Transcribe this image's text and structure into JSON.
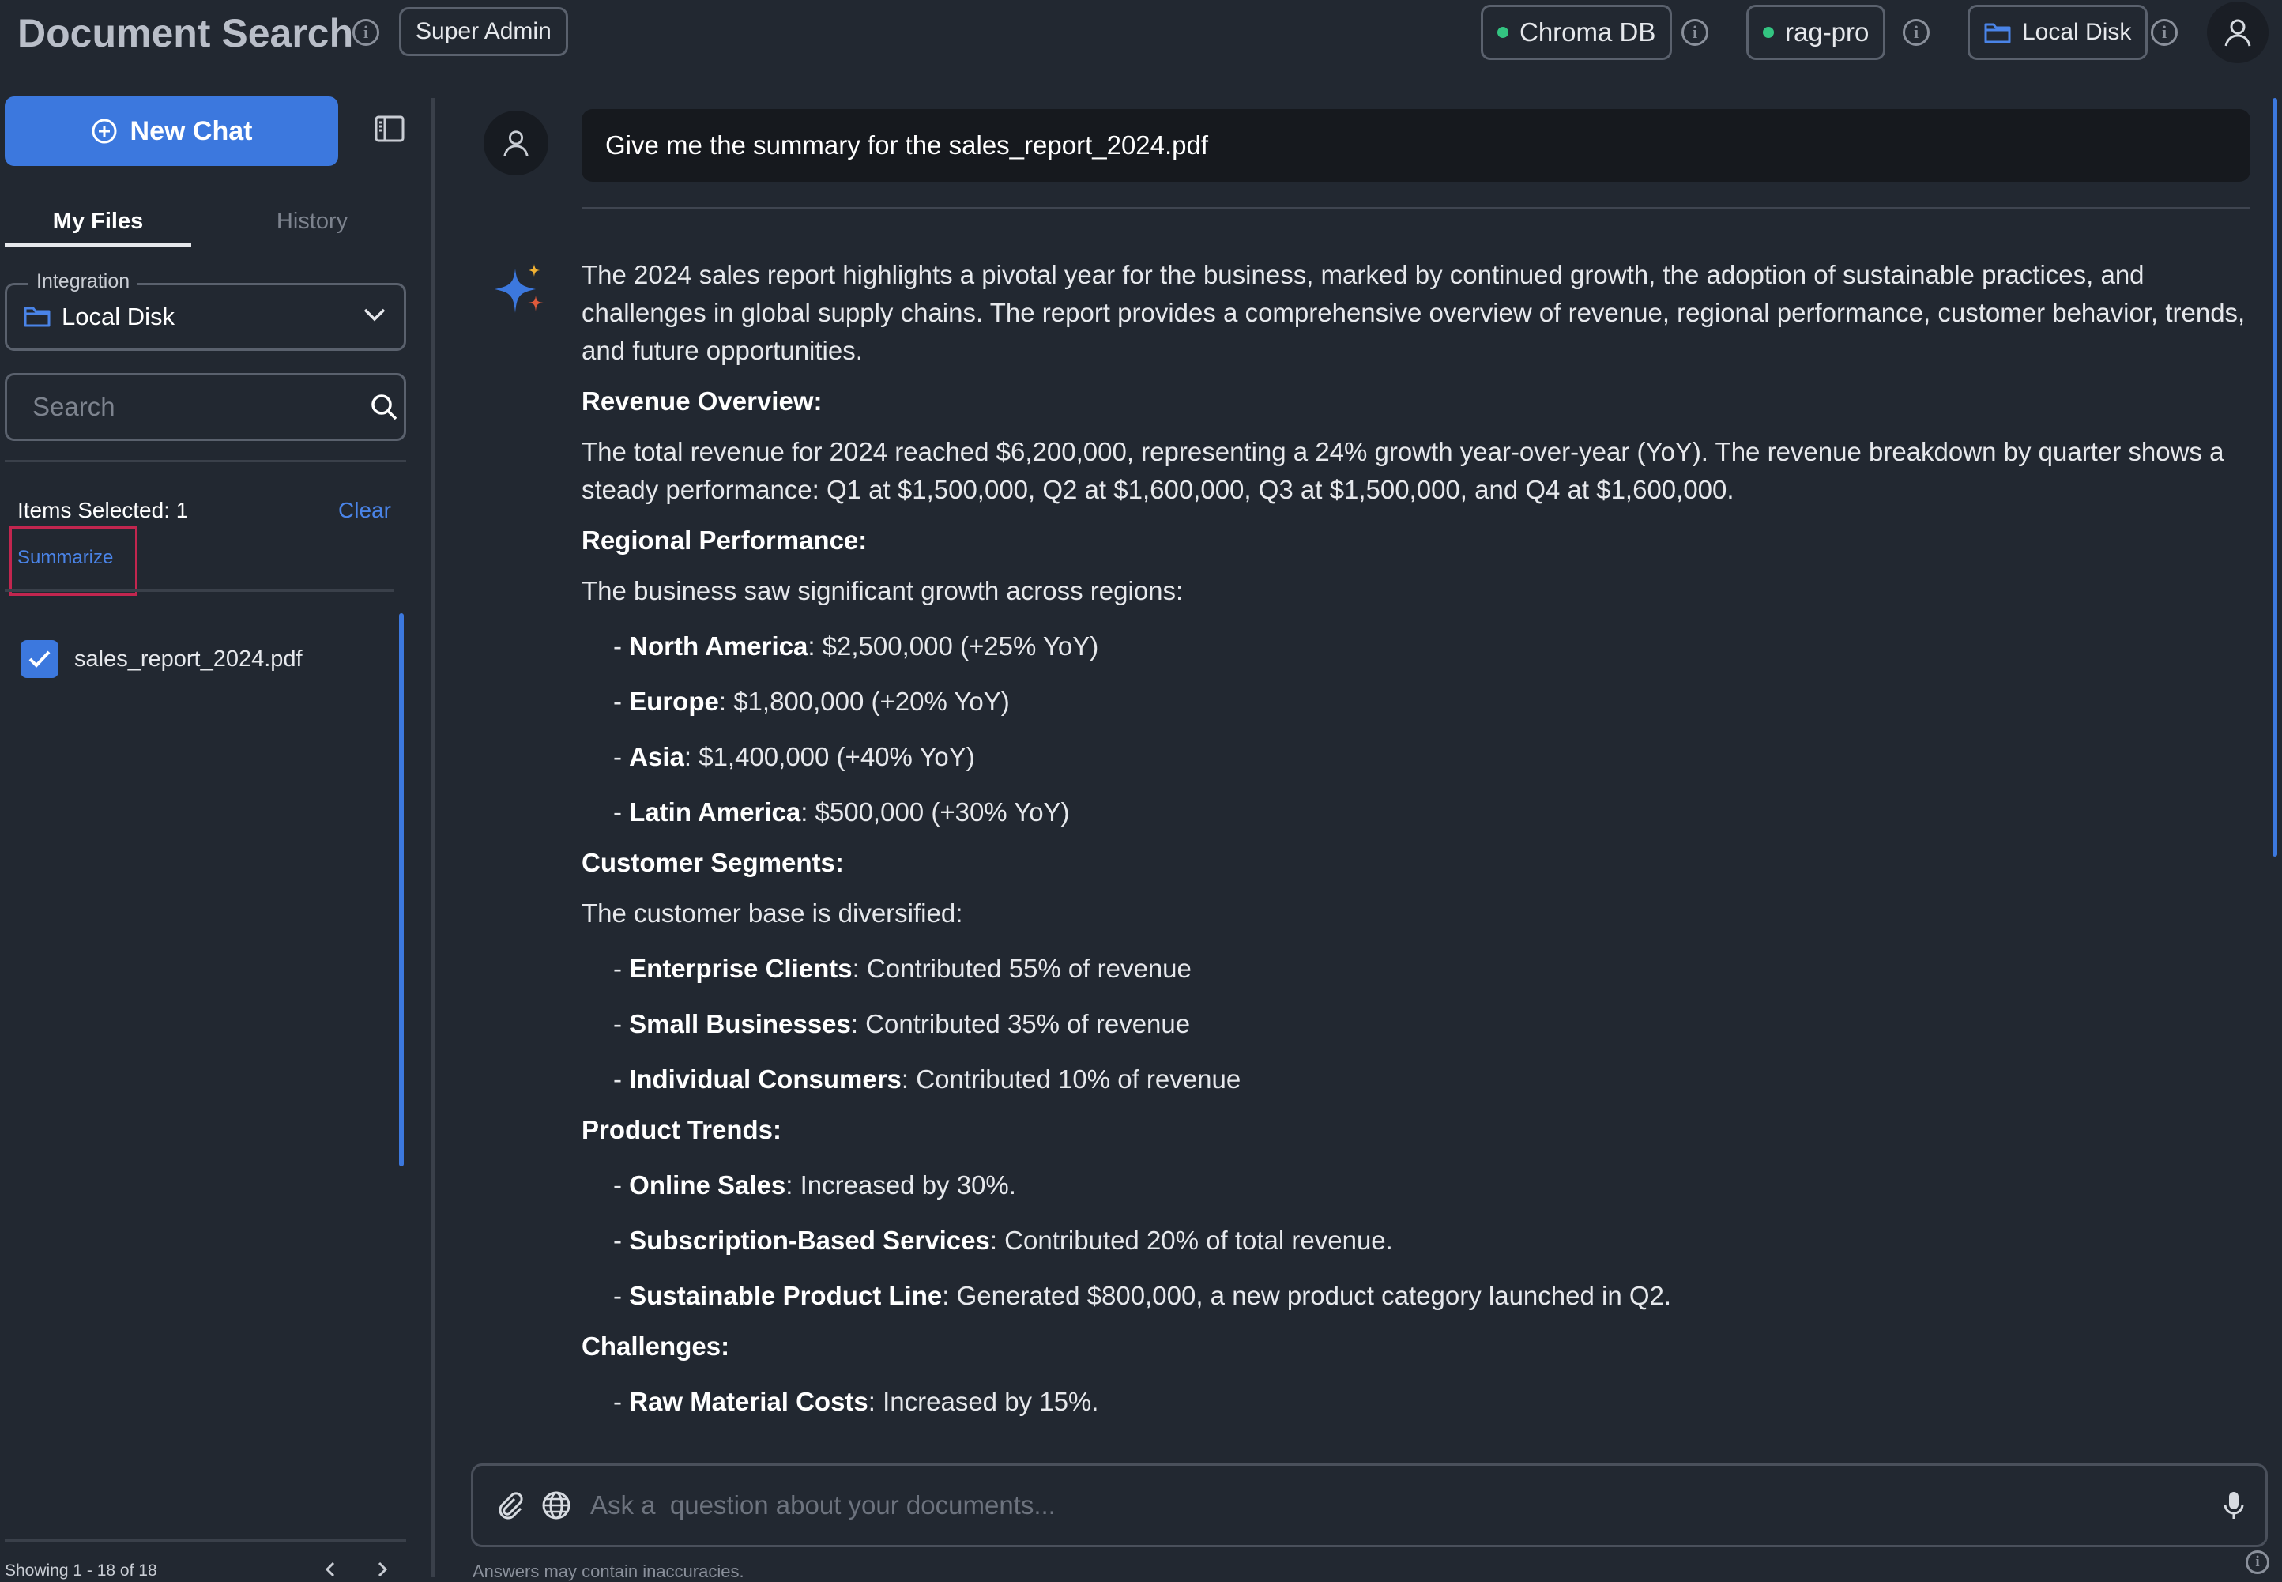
{
  "header": {
    "title": "Document Search",
    "role_badge": "Super Admin",
    "chips": [
      {
        "label": "Chroma DB",
        "status_color": "#33c481"
      },
      {
        "label": "rag-pro",
        "status_color": "#33c481"
      },
      {
        "label": "Local Disk",
        "icon": "folder-icon"
      }
    ]
  },
  "sidebar": {
    "new_chat_label": "New Chat",
    "tabs": [
      {
        "label": "My Files",
        "active": true
      },
      {
        "label": "History",
        "active": false
      }
    ],
    "integration": {
      "legend": "Integration",
      "value": "Local Disk"
    },
    "search": {
      "placeholder": "Search",
      "value": ""
    },
    "selection": {
      "text": "Items Selected: 1",
      "clear_label": "Clear",
      "summarize_label": "Summarize"
    },
    "files": [
      {
        "name": "sales_report_2024.pdf",
        "checked": true
      }
    ],
    "footer": {
      "showing": "Showing 1 - 18 of 18"
    }
  },
  "chat": {
    "user_message": "Give me the summary for the sales_report_2024.pdf",
    "answer": {
      "intro": "The 2024 sales report highlights a pivotal year for the business, marked by continued growth, the adoption of sustainable practices, and challenges in global supply chains. The report provides a comprehensive overview of revenue, regional performance, customer behavior, trends, and future opportunities.",
      "revenue_heading": "Revenue Overview",
      "revenue_text": "The total revenue for 2024 reached $6,200,000, representing a 24% growth year-over-year (YoY). The revenue breakdown by quarter shows a steady performance: Q1 at $1,500,000, Q2 at $1,600,000, Q3 at $1,500,000, and Q4 at $1,600,000.",
      "regional_heading": "Regional Performance",
      "regional_text": "The business saw significant growth across regions:",
      "regions": [
        {
          "name": "North America",
          "detail": ": $2,500,000 (+25% YoY)"
        },
        {
          "name": "Europe",
          "detail": ": $1,800,000 (+20% YoY)"
        },
        {
          "name": "Asia",
          "detail": ": $1,400,000 (+40% YoY)"
        },
        {
          "name": "Latin America",
          "detail": ": $500,000 (+30% YoY)"
        }
      ],
      "segments_heading": "Customer Segments",
      "segments_text": "The customer base is diversified:",
      "segments": [
        {
          "name": "Enterprise Clients",
          "detail": ": Contributed 55% of revenue"
        },
        {
          "name": "Small Businesses",
          "detail": ": Contributed 35% of revenue"
        },
        {
          "name": "Individual Consumers",
          "detail": ": Contributed 10% of revenue"
        }
      ],
      "trends_heading": "Product Trends",
      "trends": [
        {
          "name": "Online Sales",
          "detail": ": Increased by 30%."
        },
        {
          "name": "Subscription-Based Services",
          "detail": ": Contributed 20% of total revenue."
        },
        {
          "name": "Sustainable Product Line",
          "detail": ": Generated $800,000, a new product category launched in Q2."
        }
      ],
      "challenges_heading": "Challenges",
      "challenges": [
        {
          "name": "Raw Material Costs",
          "detail": ": Increased by 15%."
        }
      ]
    },
    "input_placeholder": "Ask a  question about your documents...",
    "disclaimer": "Answers may contain inaccuracies."
  },
  "colors": {
    "accent": "#3c78de",
    "status": "#33c481",
    "highlight_border": "#c2264f"
  }
}
